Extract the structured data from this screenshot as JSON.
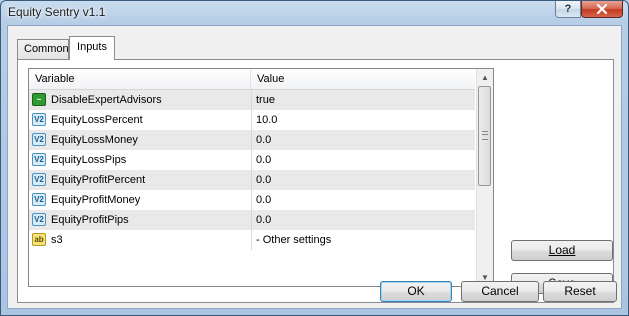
{
  "window": {
    "title": "Equity Sentry v1.1",
    "help_label": "?",
    "close_label": "✕"
  },
  "tabs": [
    {
      "label": "Common"
    },
    {
      "label": "Inputs"
    }
  ],
  "grid": {
    "headers": {
      "variable": "Variable",
      "value": "Value"
    },
    "rows": [
      {
        "icon": "bool-icon",
        "glyph": "~",
        "name": "DisableExpertAdvisors",
        "value": "true"
      },
      {
        "icon": "number-icon",
        "glyph": "V2",
        "name": "EquityLossPercent",
        "value": "10.0"
      },
      {
        "icon": "number-icon",
        "glyph": "V2",
        "name": "EquityLossMoney",
        "value": "0.0"
      },
      {
        "icon": "number-icon",
        "glyph": "V2",
        "name": "EquityLossPips",
        "value": "0.0"
      },
      {
        "icon": "number-icon",
        "glyph": "V2",
        "name": "EquityProfitPercent",
        "value": "0.0"
      },
      {
        "icon": "number-icon",
        "glyph": "V2",
        "name": "EquityProfitMoney",
        "value": "0.0"
      },
      {
        "icon": "number-icon",
        "glyph": "V2",
        "name": "EquityProfitPips",
        "value": "0.0"
      },
      {
        "icon": "string-icon",
        "glyph": "ab",
        "name": "s3",
        "value": "- Other settings"
      }
    ]
  },
  "buttons": {
    "load": "Load",
    "save": "Save",
    "ok": "OK",
    "cancel": "Cancel",
    "reset": "Reset"
  }
}
